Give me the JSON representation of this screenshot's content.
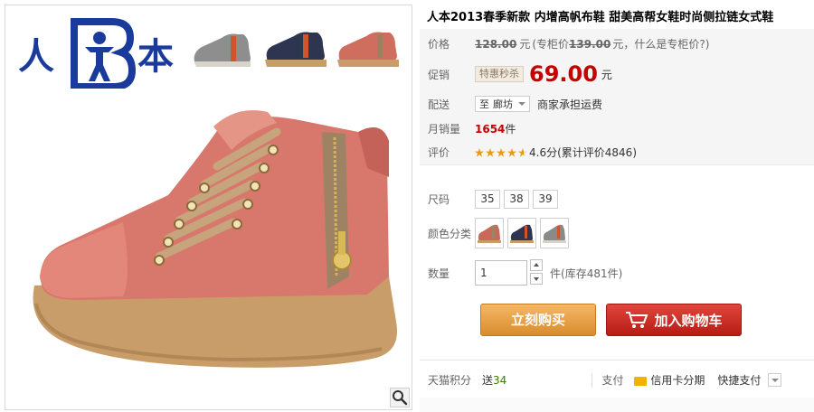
{
  "brand": {
    "logo_text_left": "人",
    "logo_text_right": "本",
    "logo_color": "#1a3b9b"
  },
  "product": {
    "title": "人本2013春季新款 内增高帆布鞋 甜美高帮女鞋时尚侧拉链女式鞋"
  },
  "price": {
    "label": "价格",
    "original": "128.00",
    "currency_unit": "元",
    "counter_prefix": "(专柜价",
    "counter_price": "139.00",
    "counter_suffix": "元，",
    "counter_link": "什么是专柜价?",
    "counter_close": ")"
  },
  "promo": {
    "label": "促销",
    "tag": "特惠秒杀",
    "price": "69.00",
    "unit": "元"
  },
  "delivery": {
    "label": "配送",
    "destination_prefix": "至",
    "destination": "廊坊",
    "shipping": "商家承担运费"
  },
  "sales": {
    "label": "月销量",
    "count": "1654",
    "unit": "件"
  },
  "rating": {
    "label": "评价",
    "stars": 4.6,
    "score_text": "4.6分",
    "review_text": "(累计评价4846)"
  },
  "size": {
    "label": "尺码",
    "options": [
      "35",
      "38",
      "39"
    ]
  },
  "color": {
    "label": "颜色分类",
    "swatches": [
      {
        "name": "pink-shoe-swatch",
        "color": "#c9695a"
      },
      {
        "name": "navy-shoe-swatch",
        "color": "#2f3550"
      },
      {
        "name": "gray-shoe-swatch",
        "color": "#8a8a8a"
      }
    ]
  },
  "quantity": {
    "label": "数量",
    "value": "1",
    "unit": "件",
    "stock": "(库存481件)"
  },
  "actions": {
    "buy_now": "立刻购买",
    "add_to_cart": "加入购物车"
  },
  "bottom": {
    "points_label": "天猫积分",
    "points_prefix": "送",
    "points_value": "34",
    "pay_label": "支付",
    "credit_label": "信用卡分期",
    "quick_pay": "快捷支付"
  },
  "colors": {
    "accent_red": "#c40000",
    "buy_orange": "#d98c2d",
    "cart_red": "#b71c15"
  }
}
